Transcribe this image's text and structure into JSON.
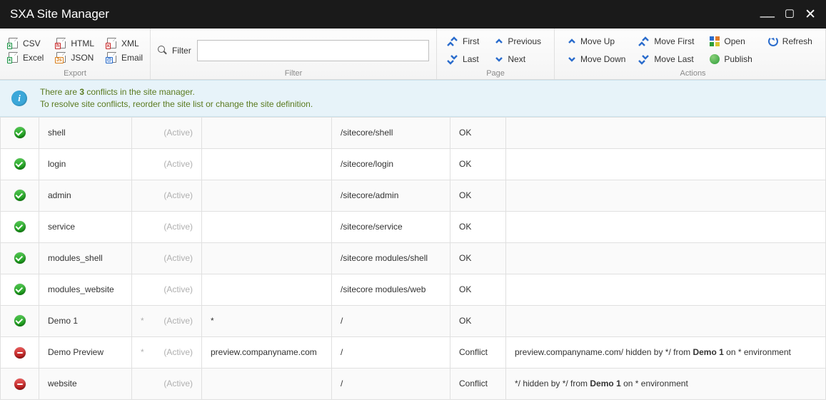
{
  "title": "SXA Site Manager",
  "ribbon": {
    "export": {
      "label": "Export",
      "csv": "CSV",
      "html": "HTML",
      "xml": "XML",
      "excel": "Excel",
      "json": "JSON",
      "email": "Email"
    },
    "filter": {
      "label": "Filter",
      "btn": "Filter",
      "value": ""
    },
    "page": {
      "label": "Page",
      "first": "First",
      "previous": "Previous",
      "last": "Last",
      "next": "Next"
    },
    "actions": {
      "label": "Actions",
      "moveUp": "Move Up",
      "moveFirst": "Move First",
      "open": "Open",
      "refresh": "Refresh",
      "moveDown": "Move Down",
      "moveLast": "Move Last",
      "publish": "Publish"
    }
  },
  "info": {
    "line1_a": "There are ",
    "line1_b": "3",
    "line1_c": " conflicts in the site manager.",
    "line2": "To resolve site conflicts, reorder the site list or change the site definition."
  },
  "activeLabel": "(Active)",
  "rows": [
    {
      "status": "ok",
      "name": "shell",
      "wild": "",
      "host": "",
      "path": "/sitecore/shell",
      "state": "OK",
      "msg": ""
    },
    {
      "status": "ok",
      "name": "login",
      "wild": "",
      "host": "",
      "path": "/sitecore/login",
      "state": "OK",
      "msg": ""
    },
    {
      "status": "ok",
      "name": "admin",
      "wild": "",
      "host": "",
      "path": "/sitecore/admin",
      "state": "OK",
      "msg": ""
    },
    {
      "status": "ok",
      "name": "service",
      "wild": "",
      "host": "",
      "path": "/sitecore/service",
      "state": "OK",
      "msg": ""
    },
    {
      "status": "ok",
      "name": "modules_shell",
      "wild": "",
      "host": "",
      "path": "/sitecore modules/shell",
      "state": "OK",
      "msg": ""
    },
    {
      "status": "ok",
      "name": "modules_website",
      "wild": "",
      "host": "",
      "path": "/sitecore modules/web",
      "state": "OK",
      "msg": ""
    },
    {
      "status": "ok",
      "name": "Demo 1",
      "wild": "*",
      "host": "*",
      "path": "/",
      "state": "OK",
      "msg": ""
    },
    {
      "status": "err",
      "name": "Demo Preview",
      "wild": "*",
      "host": "preview.companyname.com",
      "path": "/",
      "state": "Conflict",
      "msg": "preview.companyname.com/  hidden by */ from <b>Demo 1</b> on * environment"
    },
    {
      "status": "err",
      "name": "website",
      "wild": "",
      "host": "",
      "path": "/",
      "state": "Conflict",
      "msg": "*/  hidden by */ from <b>Demo 1</b> on * environment"
    }
  ]
}
